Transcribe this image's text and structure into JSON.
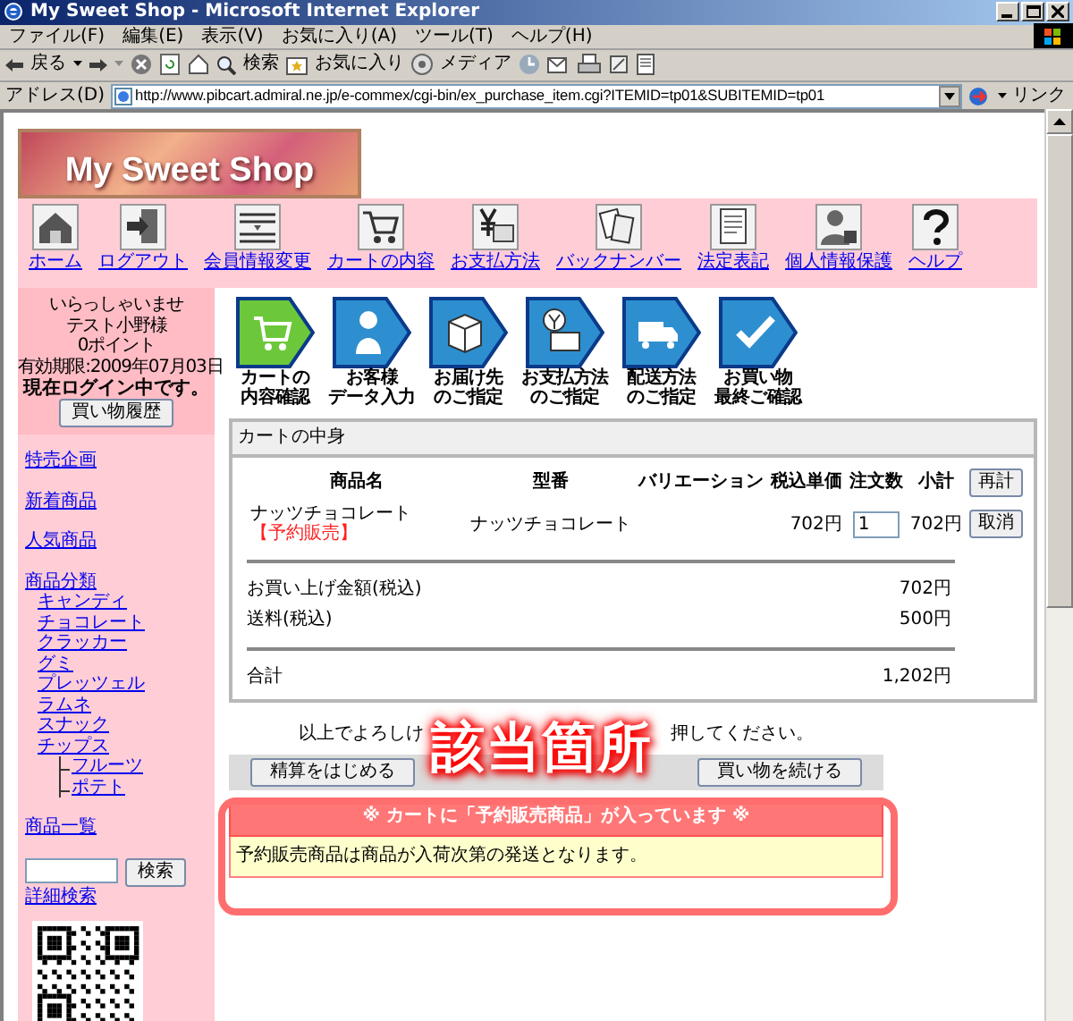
{
  "window": {
    "title": "My Sweet Shop - Microsoft Internet Explorer"
  },
  "menu_bar": [
    "ファイル(F)",
    "編集(E)",
    "表示(V)",
    "お気に入り(A)",
    "ツール(T)",
    "ヘルプ(H)"
  ],
  "toolbar": {
    "back": "戻る",
    "search": "検索",
    "favorites": "お気に入り",
    "media": "メディア"
  },
  "address_bar": {
    "label": "アドレス(D)",
    "url": "http://www.pibcart.admiral.ne.jp/e-commex/cgi-bin/ex_purchase_item.cgi?ITEMID=tp01&SUBITEMID=tp01",
    "links": "リンク"
  },
  "banner": {
    "title": "My Sweet Shop"
  },
  "nav": [
    {
      "label": "ホーム"
    },
    {
      "label": "ログアウト"
    },
    {
      "label": "会員情報変更"
    },
    {
      "label": "カートの内容"
    },
    {
      "label": "お支払方法"
    },
    {
      "label": "バックナンバー"
    },
    {
      "label": "法定表記"
    },
    {
      "label": "個人情報保護"
    },
    {
      "label": "ヘルプ"
    }
  ],
  "sidebar": {
    "welcome": [
      "いらっしゃいませ",
      "テスト小野様",
      "0ポイント",
      "有効期限:2009年07月03日"
    ],
    "login_status": "現在ログイン中です。",
    "history_button": "買い物履歴",
    "links": [
      {
        "label": "特売企画"
      },
      {
        "label": "新着商品"
      },
      {
        "label": "人気商品"
      },
      {
        "label": "商品分類",
        "children": [
          {
            "label": "キャンディ"
          },
          {
            "label": "チョコレート"
          },
          {
            "label": "クラッカー"
          },
          {
            "label": "グミ"
          },
          {
            "label": "プレッツェル"
          },
          {
            "label": "ラムネ"
          },
          {
            "label": "スナック"
          },
          {
            "label": "チップス",
            "children": [
              {
                "label": "フルーツ"
              },
              {
                "label": "ポテト"
              }
            ]
          }
        ]
      },
      {
        "label": "商品一覧"
      }
    ],
    "search_button": "検索",
    "advanced_search": "詳細検索"
  },
  "steps": [
    {
      "lines": [
        "カートの",
        "内容確認"
      ],
      "selected": true
    },
    {
      "lines": [
        "お客様",
        "データ入力"
      ],
      "selected": false
    },
    {
      "lines": [
        "お届け先",
        "のご指定"
      ],
      "selected": false
    },
    {
      "lines": [
        "お支払方法",
        "のご指定"
      ],
      "selected": false
    },
    {
      "lines": [
        "配送方法",
        "のご指定"
      ],
      "selected": false
    },
    {
      "lines": [
        "お買い物",
        "最終ご確認"
      ],
      "selected": false
    }
  ],
  "cart": {
    "title": "カートの中身",
    "columns": [
      "商品名",
      "型番",
      "バリエーション",
      "税込単価",
      "注文数",
      "小計"
    ],
    "recalc_button": "再計",
    "items": [
      {
        "name": "ナッツチョコレート",
        "tag": "【予約販売】",
        "model": "ナッツチョコレート",
        "price": "702円",
        "quantity": "1",
        "subtotal": "702円",
        "cancel_button": "取消"
      }
    ],
    "summary": [
      {
        "label": "お買い上げ金額(税込)",
        "value": "702円"
      },
      {
        "label": "送料(税込)",
        "value": "500円"
      }
    ],
    "total": {
      "label": "合計",
      "value": "1,202円"
    }
  },
  "confirm": {
    "text_parts": [
      "以上でよろしけ",
      "押してください。"
    ],
    "buttons": [
      "精算をはじめる",
      "買い物を続ける"
    ]
  },
  "notice": {
    "heading": "※ カートに「予約販売商品」が入っています ※",
    "body": "予約販売商品は商品が入荷次第の発送となります。"
  },
  "callout": {
    "label": "該当箇所"
  }
}
